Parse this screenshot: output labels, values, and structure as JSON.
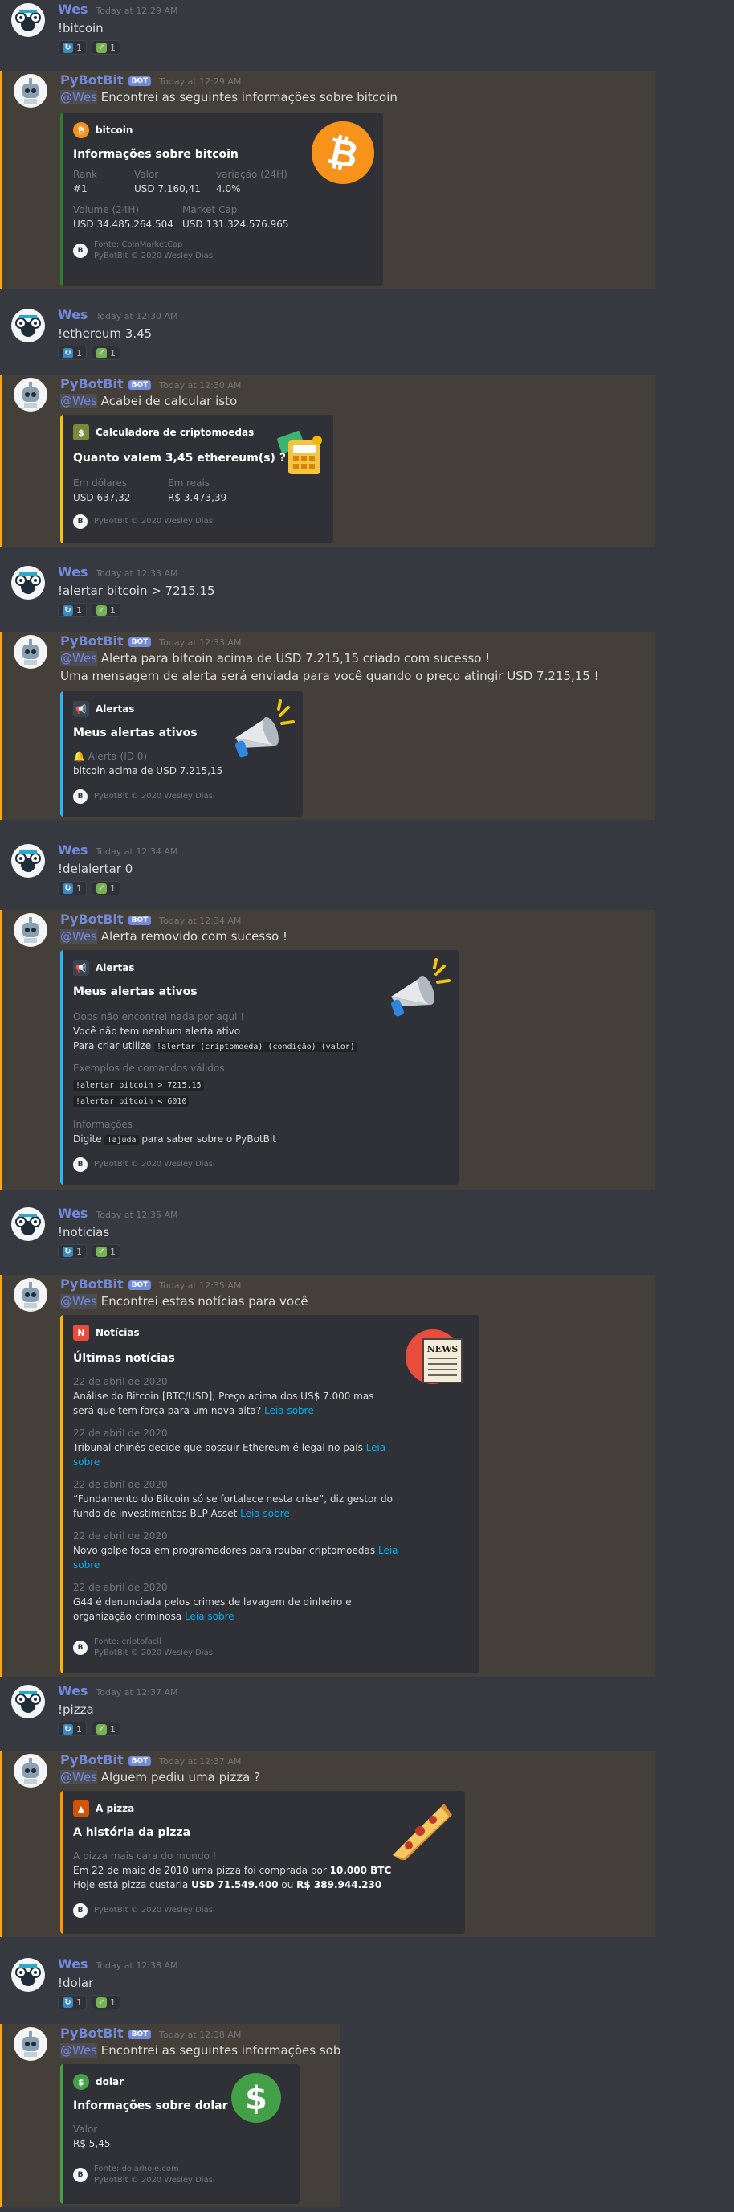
{
  "colors": {
    "background": "#36393f",
    "mention_bg": "#443f38",
    "mention_bar": "#faa61a",
    "username": "#7289da",
    "link": "#00b0f4"
  },
  "reactions": {
    "sync": {
      "icon": "arrows-counterclockwise-icon",
      "count": "1"
    },
    "check": {
      "icon": "white-check-mark-icon",
      "count": "1"
    }
  },
  "users": {
    "wes": "Wes",
    "bot": "PyBotBit",
    "bot_tag": "BOT",
    "mention": "@Wes"
  },
  "m1": {
    "time": "Today at 12:29 AM",
    "text": "!bitcoin"
  },
  "m2": {
    "time": "Today at 12:29 AM",
    "text": "Encontrei as seguintes informações sobre bitcoin",
    "embed": {
      "author": "bitcoin",
      "title": "Informações sobre bitcoin",
      "f1n": "Rank",
      "f1v": "#1",
      "f2n": "Valor",
      "f2v": "USD 7.160,41",
      "f3n": "variação (24H)",
      "f3v": "4.0%",
      "f4n": "Volume (24H)",
      "f4v": "USD 34.485.264.504",
      "f5n": "Market Cap",
      "f5v": "USD 131.324.576.965",
      "foot1": "Fonte: CoinMarketCap",
      "foot2": "PyBotBit © 2020 Wesley Dias"
    }
  },
  "m3": {
    "time": "Today at 12:30 AM",
    "text": "!ethereum 3.45"
  },
  "m4": {
    "time": "Today at 12:30 AM",
    "text": "Acabei de calcular isto",
    "embed": {
      "author": "Calculadora de criptomoedas",
      "title": "Quanto valem 3,45 ethereum(s) ?",
      "f1n": "Em dólares",
      "f1v": "USD 637,32",
      "f2n": "Em reais",
      "f2v": "R$ 3.473,39",
      "foot": "PyBotBit © 2020 Wesley Dias"
    }
  },
  "m5": {
    "time": "Today at 12:33 AM",
    "text": "!alertar bitcoin > 7215.15"
  },
  "m6": {
    "time": "Today at 12:33 AM",
    "text": "Alerta para bitcoin acima de USD 7.215,15 criado com sucesso !",
    "text2": "Uma mensagem de alerta será enviada para você quando o preço atingir USD 7.215,15 !",
    "embed": {
      "author": "Alertas",
      "title": "Meus alertas ativos",
      "f1n": "Alerta (ID 0)",
      "f1v": "bitcoin acima de USD 7.215,15",
      "foot": "PyBotBit © 2020 Wesley Dias"
    }
  },
  "m7": {
    "time": "Today at 12:34 AM",
    "text": "!delalertar 0"
  },
  "m8": {
    "time": "Today at 12:34 AM",
    "text": "Alerta removido com sucesso !",
    "embed": {
      "author": "Alertas",
      "title": "Meus alertas ativos",
      "f1n": "Oops não encontrei nada por aqui !",
      "l1": "Você não tem nenhum alerta ativo",
      "l2a": "Para criar utilize",
      "l2code": "!alertar (criptomoeda) (condição) (valor)",
      "f2n": "Exemplos de comandos válidos",
      "c1": "!alertar bitcoin > 7215.15",
      "c2": "!alertar bitcoin < 6010",
      "f3n": "Informações",
      "l3a": "Digite",
      "l3code": "!ajuda",
      "l3b": "para saber sobre o PyBotBit",
      "foot": "PyBotBit © 2020 Wesley Dias"
    }
  },
  "m9": {
    "time": "Today at 12:35 AM",
    "text": "!noticias"
  },
  "m10": {
    "time": "Today at 12:35 AM",
    "text": "Encontrei estas notícias para você",
    "embed": {
      "author": "Notícias",
      "title": "Últimas notícias",
      "thumb_text": "NEWS",
      "n1d": "22 de abril de 2020",
      "n1a": "Análise do Bitcoin [BTC/USD]; Preço acima dos US$ 7.000 mas",
      "n1b": "será que tem força para um nova alta?",
      "n1l": "Leia sobre",
      "n2d": "22 de abril de 2020",
      "n2a": "Tribunal chinês decide que possuir Ethereum é legal no país",
      "n2l1": "Leia",
      "n2l2": "sobre",
      "n3d": "22 de abril de 2020",
      "n3a": "“Fundamento do Bitcoin só se fortalece nesta crise”, diz gestor do",
      "n3b": "fundo de investimentos BLP Asset",
      "n3l": "Leia sobre",
      "n4d": "22 de abril de 2020",
      "n4a": "Novo golpe foca em programadores para roubar criptomoedas",
      "n4l1": "Leia",
      "n4l2": "sobre",
      "n5d": "22 de abril de 2020",
      "n5a": "G44 é denunciada pelos crimes de lavagem de dinheiro e",
      "n5b": "organização criminosa",
      "n5l": "Leia sobre",
      "foot1": "Fonte: criptofacil",
      "foot2": "PyBotBit © 2020 Wesley Dias"
    }
  },
  "m11": {
    "time": "Today at 12:37 AM",
    "text": "!pizza"
  },
  "m12": {
    "time": "Today at 12:37 AM",
    "text": "Alguem pediu uma pizza ?",
    "embed": {
      "author": "A pizza",
      "title": "A história da pizza",
      "f1n": "A pizza mais cara do mundo !",
      "l1a": "Em 22 de maio de 2010 uma pizza foi comprada por",
      "l1b": "10.000 BTC",
      "l2a": "Hoje está pizza custaria",
      "l2b": "USD 71.549.400",
      "l2c": "ou",
      "l2d": "R$ 389.944.230",
      "foot": "PyBotBit © 2020 Wesley Dias"
    }
  },
  "m13": {
    "time": "Today at 12:38 AM",
    "text": "!dolar"
  },
  "m14": {
    "time": "Today at 12:38 AM",
    "text": "Encontrei as seguintes informações sobre dolar",
    "embed": {
      "author": "dolar",
      "title": "Informações sobre dolar",
      "f1n": "Valor",
      "f1v": "R$ 5,45",
      "foot1": "Fonte: dolarhoje.com",
      "foot2": "PyBotBit © 2020 Wesley Dias"
    }
  }
}
